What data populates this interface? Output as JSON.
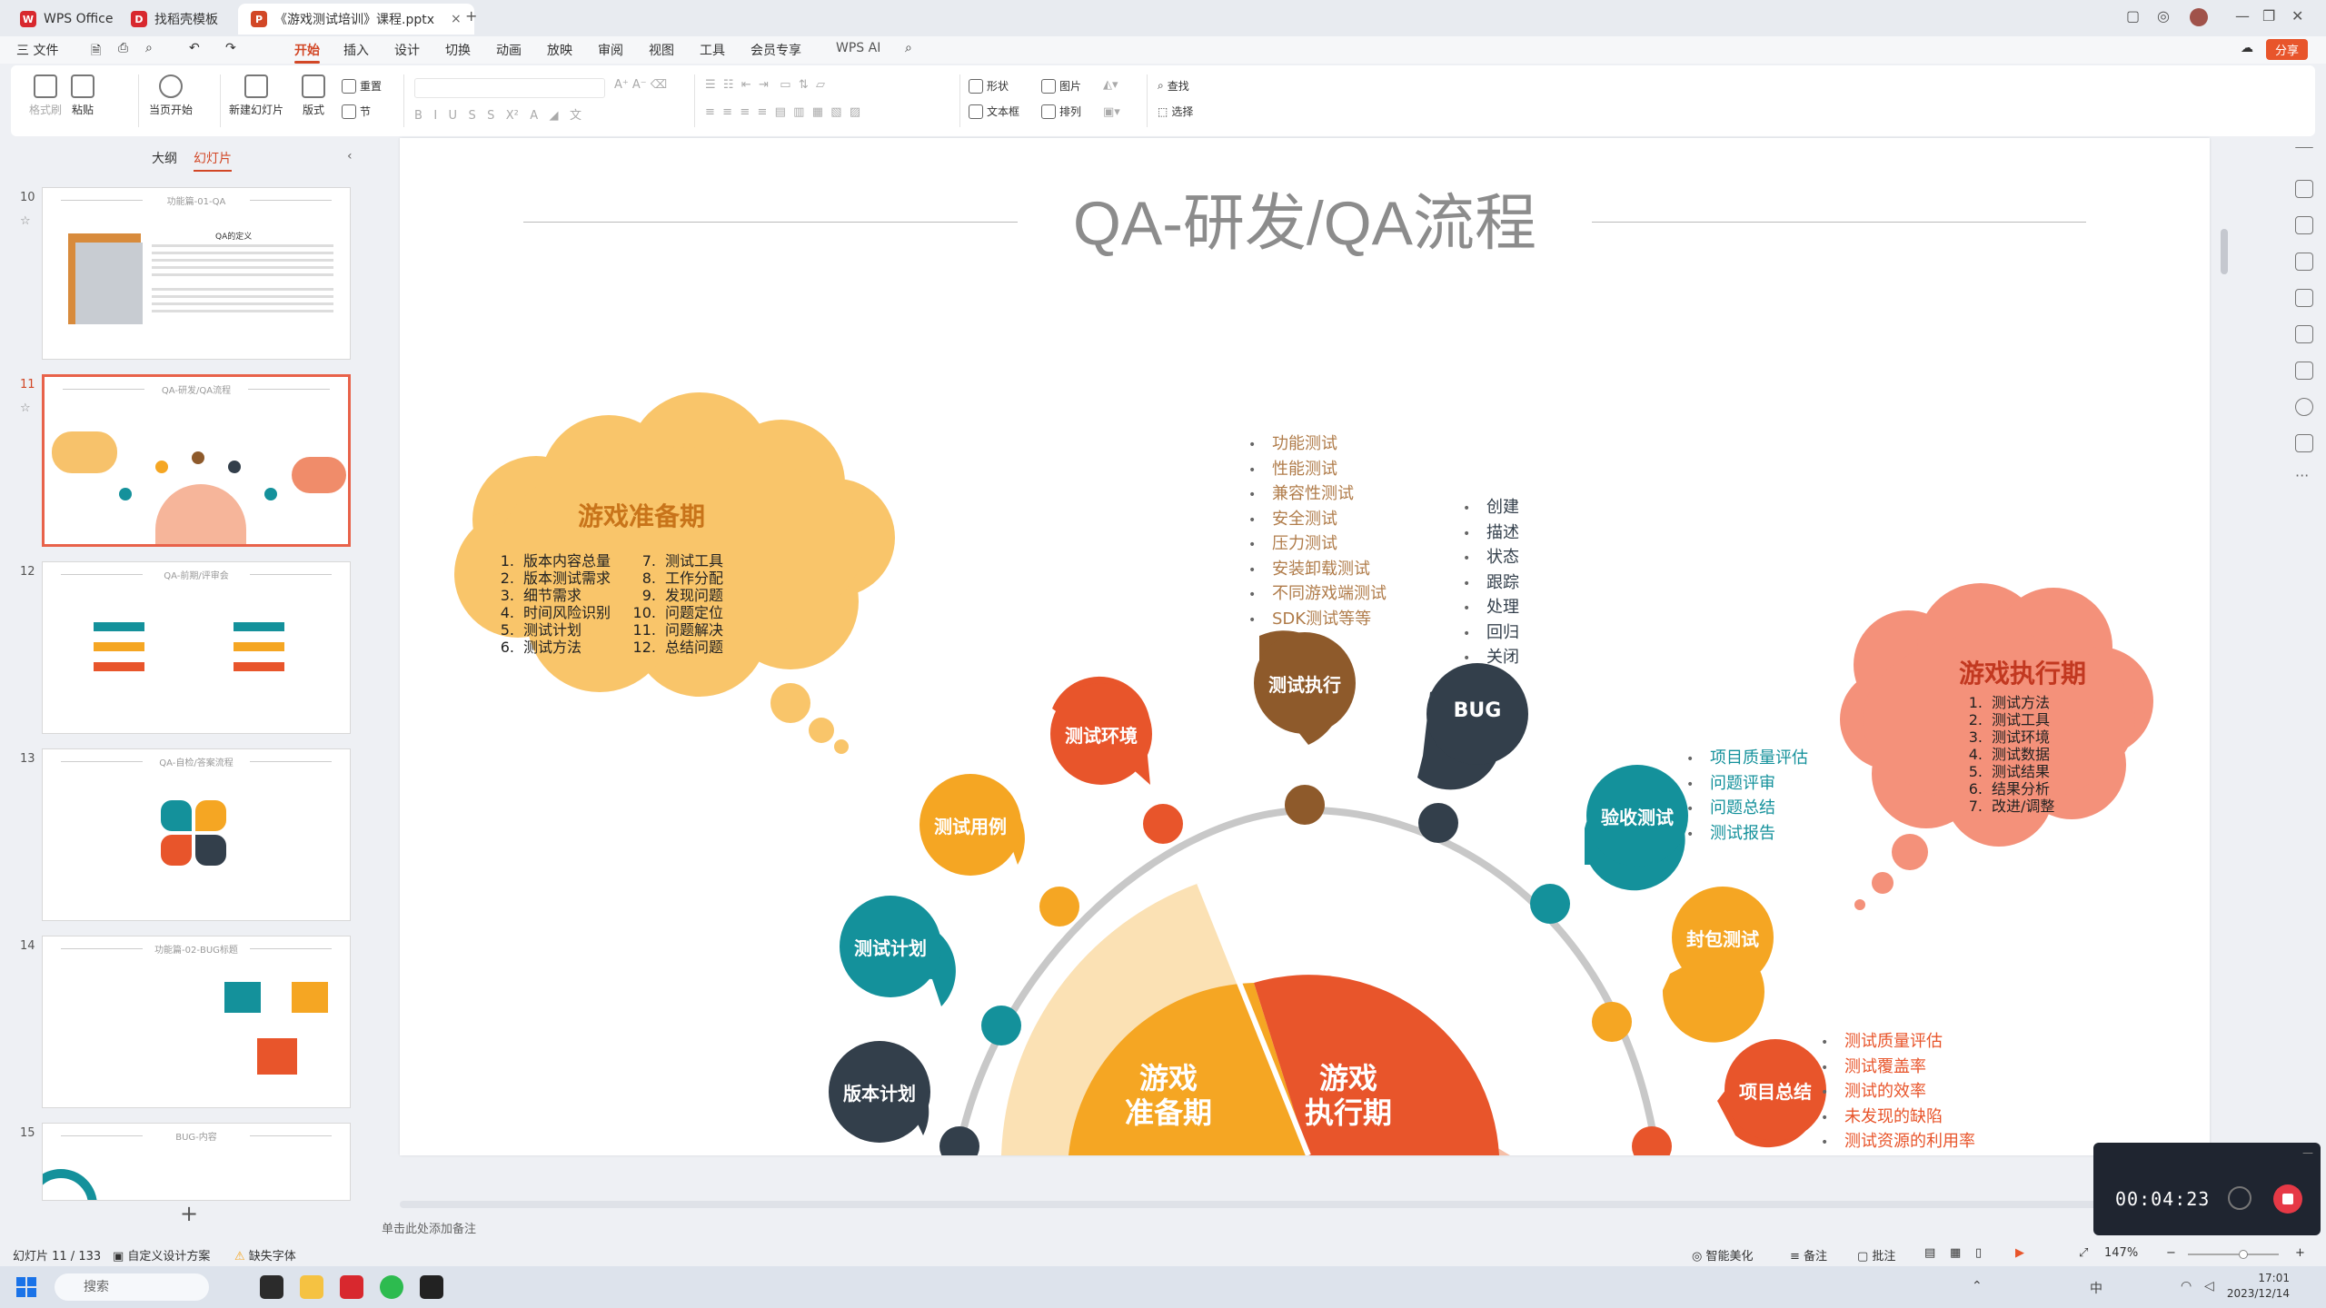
{
  "tabs": [
    {
      "label": "WPS Office",
      "icon": "wps-logo-icon",
      "color": "#d8282e"
    },
    {
      "label": "找稻壳模板",
      "icon": "docer-icon",
      "color": "#d8282e"
    },
    {
      "label": "《游戏测试培训》课程.pptx",
      "icon": "ppt-file-icon",
      "color": "#d24726"
    }
  ],
  "menu": {
    "file": "三 文件",
    "items": [
      "开始",
      "插入",
      "设计",
      "切换",
      "动画",
      "放映",
      "审阅",
      "视图",
      "工具",
      "会员专享"
    ],
    "active": "开始",
    "wps_ai": "WPS AI",
    "share": "分享"
  },
  "ribbon": {
    "format_painter": "格式刷",
    "paste": "粘贴",
    "from_current": "当页开始",
    "new_slide": "新建幻灯片",
    "layout": "版式",
    "section": "节",
    "reset": "重置",
    "shape": "形状",
    "picture": "图片",
    "find": "查找",
    "textbox": "文本框",
    "arrange": "排列",
    "select": "选择"
  },
  "left_panel": {
    "tab_outline": "大纲",
    "tab_slides": "幻灯片",
    "thumbs": [
      {
        "num": "10",
        "title": "功能篇-01-QA"
      },
      {
        "num": "11",
        "title": "QA-研发/QA流程"
      },
      {
        "num": "12",
        "title": "QA-前期/评审会"
      },
      {
        "num": "13",
        "title": "QA-自检/答案流程"
      },
      {
        "num": "14",
        "title": "功能篇-02-BUG标题"
      },
      {
        "num": "15",
        "title": "BUG-内容"
      }
    ],
    "thumb10_heading": "QA的定义"
  },
  "slide": {
    "title": "QA-研发/QA流程",
    "prep_cloud": {
      "title": "游戏准备期",
      "left": [
        {
          "n": "1.",
          "t": "版本内容总量"
        },
        {
          "n": "2.",
          "t": "版本测试需求"
        },
        {
          "n": "3.",
          "t": "细节需求"
        },
        {
          "n": "4.",
          "t": "时间风险识别"
        },
        {
          "n": "5.",
          "t": "测试计划"
        },
        {
          "n": "6.",
          "t": "测试方法"
        }
      ],
      "right": [
        {
          "n": "7.",
          "t": "测试工具"
        },
        {
          "n": "8.",
          "t": "工作分配"
        },
        {
          "n": "9.",
          "t": "发现问题"
        },
        {
          "n": "10.",
          "t": "问题定位"
        },
        {
          "n": "11.",
          "t": "问题解决"
        },
        {
          "n": "12.",
          "t": "总结问题"
        }
      ]
    },
    "exec_cloud": {
      "title": "游戏执行期",
      "items": [
        {
          "n": "1.",
          "t": "测试方法"
        },
        {
          "n": "2.",
          "t": "测试工具"
        },
        {
          "n": "3.",
          "t": "测试环境"
        },
        {
          "n": "4.",
          "t": "测试数据"
        },
        {
          "n": "5.",
          "t": "测试结果"
        },
        {
          "n": "6.",
          "t": "结果分析"
        },
        {
          "n": "7.",
          "t": "改进/调整"
        }
      ]
    },
    "pins": {
      "version_plan": "版本计划",
      "test_plan": "测试计划",
      "test_case": "测试用例",
      "test_env": "测试环境",
      "test_exec": "测试执行",
      "bug": "BUG",
      "acceptance": "验收测试",
      "package": "封包测试",
      "summary": "项目总结"
    },
    "exec_list": [
      "功能测试",
      "性能测试",
      "兼容性测试",
      "安全测试",
      "压力测试",
      "安装卸载测试",
      "不同游戏端测试",
      "SDK测试等等"
    ],
    "bug_list": [
      "创建",
      "描述",
      "状态",
      "跟踪",
      "处理",
      "回归",
      "关闭"
    ],
    "accept_list": [
      "项目质量评估",
      "问题评审",
      "问题总结",
      "测试报告"
    ],
    "summary_list": [
      "测试质量评估",
      "测试覆盖率",
      "测试的效率",
      "未发现的缺陷",
      "测试资源的利用率"
    ],
    "center_left": [
      "游戏",
      "准备期"
    ],
    "center_right": [
      "游戏",
      "执行期"
    ]
  },
  "notes_placeholder": "单击此处添加备注",
  "status": {
    "slide_count": "幻灯片 11 / 133",
    "design": "自定义设计方案",
    "missing_font": "缺失字体",
    "smart": "智能美化",
    "notes": "备注",
    "comments": "批注",
    "zoom": "147%"
  },
  "recorder": {
    "time": "00:04:23"
  },
  "taskbar": {
    "search": "搜索",
    "time": "17:01",
    "date": "2023/12/14"
  },
  "colors": {
    "accent": "#d24726",
    "teal": "#14919b",
    "orange": "#f5a623",
    "red_orange": "#e8552b",
    "brown": "#8e5a2b",
    "navy": "#333f4b",
    "light_peach": "#f6c0a6",
    "cream": "#fbe0b0"
  }
}
